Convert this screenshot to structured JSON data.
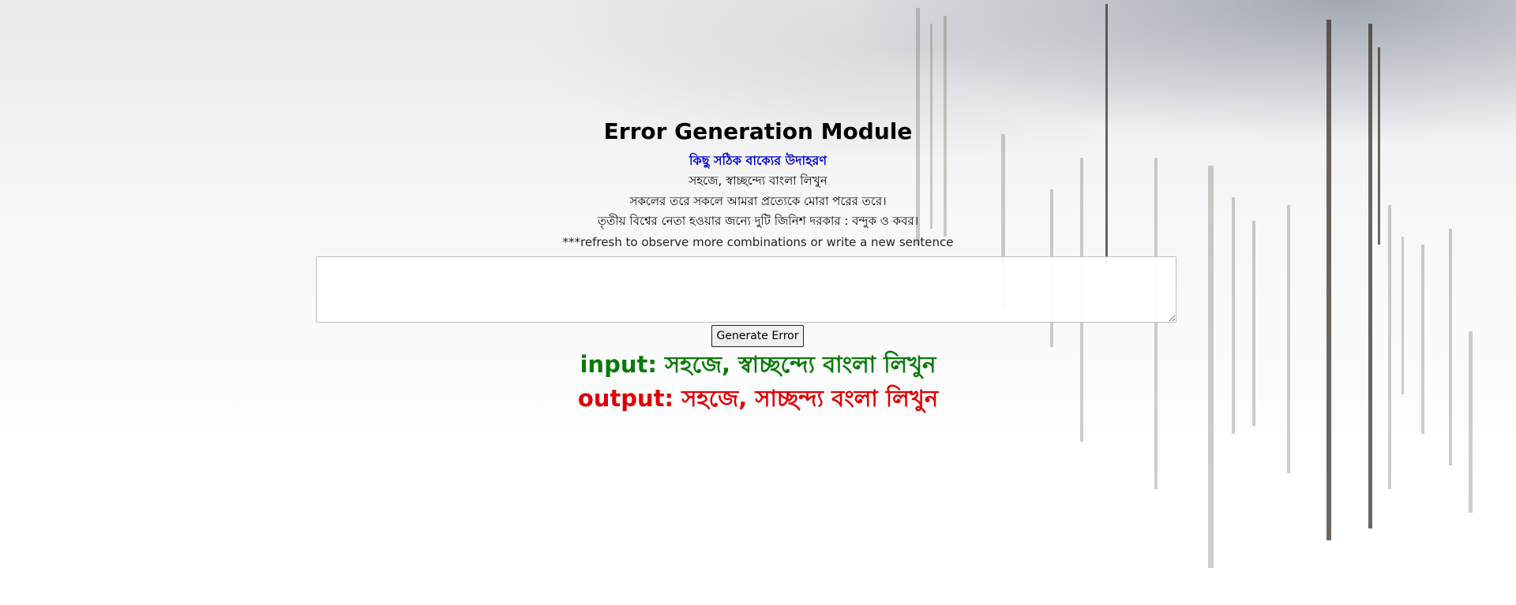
{
  "page": {
    "title": "Error Generation Module",
    "subtitle": "কিছু সঠিক বাক্যের উদাহরণ",
    "examples": [
      "সহজে, স্বাচ্ছন্দ্যে বাংলা লিখুন",
      "সকলের তরে সকলে আমরা প্রত্যেকে মোরা পরের তরে।",
      "তৃতীয় বিশ্বের নেতা হওয়ার জন্যে দুটি জিনিশ দরকার : বন্দুক ও কবর।"
    ],
    "note": "***refresh to observe more combinations or write a new sentence"
  },
  "form": {
    "textarea_value": "",
    "button_label": "Generate Error"
  },
  "result": {
    "input_label": "input:",
    "input_text": "সহজে, স্বাচ্ছন্দ্যে বাংলা লিখুন",
    "output_label": "output:",
    "output_text": "সহজে, সাচ্ছন্দ্য বংলা লিখুন"
  },
  "colors": {
    "subtitle": "#0000cc",
    "input": "#0a7a0a",
    "output": "#dd0000"
  }
}
